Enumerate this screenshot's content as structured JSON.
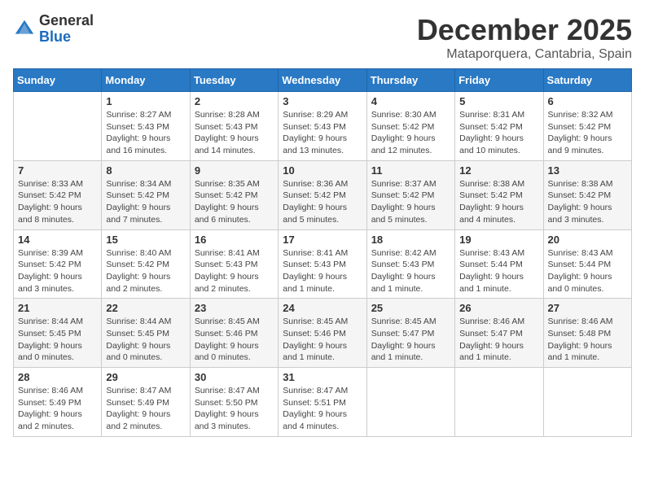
{
  "logo": {
    "general": "General",
    "blue": "Blue"
  },
  "title": "December 2025",
  "location": "Mataporquera, Cantabria, Spain",
  "headers": [
    "Sunday",
    "Monday",
    "Tuesday",
    "Wednesday",
    "Thursday",
    "Friday",
    "Saturday"
  ],
  "weeks": [
    [
      {
        "day": "",
        "sunrise": "",
        "sunset": "",
        "daylight": ""
      },
      {
        "day": "1",
        "sunrise": "Sunrise: 8:27 AM",
        "sunset": "Sunset: 5:43 PM",
        "daylight": "Daylight: 9 hours and 16 minutes."
      },
      {
        "day": "2",
        "sunrise": "Sunrise: 8:28 AM",
        "sunset": "Sunset: 5:43 PM",
        "daylight": "Daylight: 9 hours and 14 minutes."
      },
      {
        "day": "3",
        "sunrise": "Sunrise: 8:29 AM",
        "sunset": "Sunset: 5:43 PM",
        "daylight": "Daylight: 9 hours and 13 minutes."
      },
      {
        "day": "4",
        "sunrise": "Sunrise: 8:30 AM",
        "sunset": "Sunset: 5:42 PM",
        "daylight": "Daylight: 9 hours and 12 minutes."
      },
      {
        "day": "5",
        "sunrise": "Sunrise: 8:31 AM",
        "sunset": "Sunset: 5:42 PM",
        "daylight": "Daylight: 9 hours and 10 minutes."
      },
      {
        "day": "6",
        "sunrise": "Sunrise: 8:32 AM",
        "sunset": "Sunset: 5:42 PM",
        "daylight": "Daylight: 9 hours and 9 minutes."
      }
    ],
    [
      {
        "day": "7",
        "sunrise": "Sunrise: 8:33 AM",
        "sunset": "Sunset: 5:42 PM",
        "daylight": "Daylight: 9 hours and 8 minutes."
      },
      {
        "day": "8",
        "sunrise": "Sunrise: 8:34 AM",
        "sunset": "Sunset: 5:42 PM",
        "daylight": "Daylight: 9 hours and 7 minutes."
      },
      {
        "day": "9",
        "sunrise": "Sunrise: 8:35 AM",
        "sunset": "Sunset: 5:42 PM",
        "daylight": "Daylight: 9 hours and 6 minutes."
      },
      {
        "day": "10",
        "sunrise": "Sunrise: 8:36 AM",
        "sunset": "Sunset: 5:42 PM",
        "daylight": "Daylight: 9 hours and 5 minutes."
      },
      {
        "day": "11",
        "sunrise": "Sunrise: 8:37 AM",
        "sunset": "Sunset: 5:42 PM",
        "daylight": "Daylight: 9 hours and 5 minutes."
      },
      {
        "day": "12",
        "sunrise": "Sunrise: 8:38 AM",
        "sunset": "Sunset: 5:42 PM",
        "daylight": "Daylight: 9 hours and 4 minutes."
      },
      {
        "day": "13",
        "sunrise": "Sunrise: 8:38 AM",
        "sunset": "Sunset: 5:42 PM",
        "daylight": "Daylight: 9 hours and 3 minutes."
      }
    ],
    [
      {
        "day": "14",
        "sunrise": "Sunrise: 8:39 AM",
        "sunset": "Sunset: 5:42 PM",
        "daylight": "Daylight: 9 hours and 3 minutes."
      },
      {
        "day": "15",
        "sunrise": "Sunrise: 8:40 AM",
        "sunset": "Sunset: 5:42 PM",
        "daylight": "Daylight: 9 hours and 2 minutes."
      },
      {
        "day": "16",
        "sunrise": "Sunrise: 8:41 AM",
        "sunset": "Sunset: 5:43 PM",
        "daylight": "Daylight: 9 hours and 2 minutes."
      },
      {
        "day": "17",
        "sunrise": "Sunrise: 8:41 AM",
        "sunset": "Sunset: 5:43 PM",
        "daylight": "Daylight: 9 hours and 1 minute."
      },
      {
        "day": "18",
        "sunrise": "Sunrise: 8:42 AM",
        "sunset": "Sunset: 5:43 PM",
        "daylight": "Daylight: 9 hours and 1 minute."
      },
      {
        "day": "19",
        "sunrise": "Sunrise: 8:43 AM",
        "sunset": "Sunset: 5:44 PM",
        "daylight": "Daylight: 9 hours and 1 minute."
      },
      {
        "day": "20",
        "sunrise": "Sunrise: 8:43 AM",
        "sunset": "Sunset: 5:44 PM",
        "daylight": "Daylight: 9 hours and 0 minutes."
      }
    ],
    [
      {
        "day": "21",
        "sunrise": "Sunrise: 8:44 AM",
        "sunset": "Sunset: 5:45 PM",
        "daylight": "Daylight: 9 hours and 0 minutes."
      },
      {
        "day": "22",
        "sunrise": "Sunrise: 8:44 AM",
        "sunset": "Sunset: 5:45 PM",
        "daylight": "Daylight: 9 hours and 0 minutes."
      },
      {
        "day": "23",
        "sunrise": "Sunrise: 8:45 AM",
        "sunset": "Sunset: 5:46 PM",
        "daylight": "Daylight: 9 hours and 0 minutes."
      },
      {
        "day": "24",
        "sunrise": "Sunrise: 8:45 AM",
        "sunset": "Sunset: 5:46 PM",
        "daylight": "Daylight: 9 hours and 1 minute."
      },
      {
        "day": "25",
        "sunrise": "Sunrise: 8:45 AM",
        "sunset": "Sunset: 5:47 PM",
        "daylight": "Daylight: 9 hours and 1 minute."
      },
      {
        "day": "26",
        "sunrise": "Sunrise: 8:46 AM",
        "sunset": "Sunset: 5:47 PM",
        "daylight": "Daylight: 9 hours and 1 minute."
      },
      {
        "day": "27",
        "sunrise": "Sunrise: 8:46 AM",
        "sunset": "Sunset: 5:48 PM",
        "daylight": "Daylight: 9 hours and 1 minute."
      }
    ],
    [
      {
        "day": "28",
        "sunrise": "Sunrise: 8:46 AM",
        "sunset": "Sunset: 5:49 PM",
        "daylight": "Daylight: 9 hours and 2 minutes."
      },
      {
        "day": "29",
        "sunrise": "Sunrise: 8:47 AM",
        "sunset": "Sunset: 5:49 PM",
        "daylight": "Daylight: 9 hours and 2 minutes."
      },
      {
        "day": "30",
        "sunrise": "Sunrise: 8:47 AM",
        "sunset": "Sunset: 5:50 PM",
        "daylight": "Daylight: 9 hours and 3 minutes."
      },
      {
        "day": "31",
        "sunrise": "Sunrise: 8:47 AM",
        "sunset": "Sunset: 5:51 PM",
        "daylight": "Daylight: 9 hours and 4 minutes."
      },
      {
        "day": "",
        "sunrise": "",
        "sunset": "",
        "daylight": ""
      },
      {
        "day": "",
        "sunrise": "",
        "sunset": "",
        "daylight": ""
      },
      {
        "day": "",
        "sunrise": "",
        "sunset": "",
        "daylight": ""
      }
    ]
  ]
}
